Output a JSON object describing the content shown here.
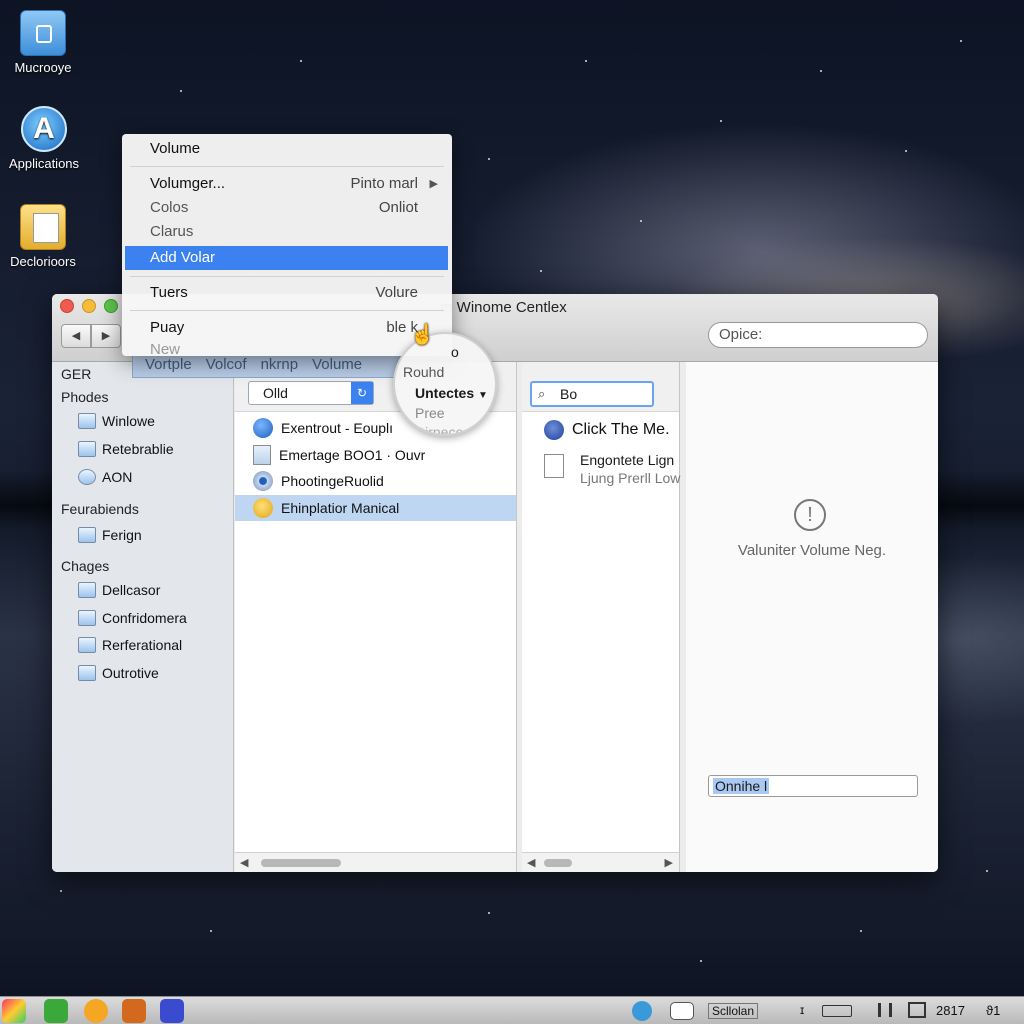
{
  "desktop": {
    "icons": [
      {
        "label": "Mucrooye",
        "icon": "folder-lock-icon"
      },
      {
        "label": "Applications",
        "icon": "app-store-icon"
      },
      {
        "label": "Declorioors",
        "icon": "documents-folder-icon"
      }
    ]
  },
  "context_menu": {
    "header": "Volume",
    "items": [
      {
        "label": "Volumger...",
        "shortcut": "Pinto marl"
      },
      {
        "label": "Colos",
        "shortcut": "Onliot"
      },
      {
        "label": "Clarus",
        "shortcut": ""
      },
      {
        "label": "Add Volar",
        "shortcut": ""
      },
      {
        "label": "Tuers",
        "shortcut": "Volure"
      },
      {
        "label": "Puay",
        "shortcut": "ble k"
      },
      {
        "label": "New",
        "shortcut": ""
      }
    ],
    "toolbar_strip": [
      "Vortple",
      "Volcof",
      "nkrnp",
      "Volume"
    ]
  },
  "window": {
    "title": "m Winome Centlex",
    "search_placeholder": "Opice:",
    "nav": {
      "back": "◀",
      "forward": "▶"
    },
    "sidebar": {
      "sections": [
        {
          "header": "GER",
          "items": []
        },
        {
          "header": "Phodes",
          "items": [
            "Winlowe",
            "Retebrablie",
            "AON"
          ]
        },
        {
          "header": "Feurabiends",
          "items": [
            "Ferign"
          ]
        },
        {
          "header": "Chages",
          "items": [
            "Dellcasor",
            "Confridomera",
            "Rerferational",
            "Outrotive"
          ]
        }
      ]
    },
    "column1": {
      "filter_value": "Olld",
      "rows": [
        {
          "label": "Exentrout - Eouplı",
          "icon": "help-icon"
        },
        {
          "label": "Emertage BOO1 · Ouvr",
          "icon": "document-icon"
        },
        {
          "label": "PhootingeRuolid",
          "icon": "disk-icon"
        },
        {
          "label": "Ehinplatior Manical",
          "icon": "bell-icon",
          "selected": true
        }
      ]
    },
    "column2": {
      "search_value": "Bo",
      "rows": [
        {
          "label": "Click The Me.",
          "icon": "info-icon"
        },
        {
          "label": "Engontete Lign",
          "sublabel": "Ljung Prerll Low",
          "icon": "document-icon"
        }
      ]
    },
    "preview": {
      "message": "Valuniter Volume Neg.",
      "field_value": "Onnihe l"
    }
  },
  "magnifier": {
    "lines": [
      "o",
      "Rouhd",
      "Untectes",
      "Pree",
      "Dirnece"
    ]
  },
  "taskbar": {
    "tray": [
      "Scllolan",
      "ɪ",
      "2817",
      "ϑ1"
    ]
  }
}
